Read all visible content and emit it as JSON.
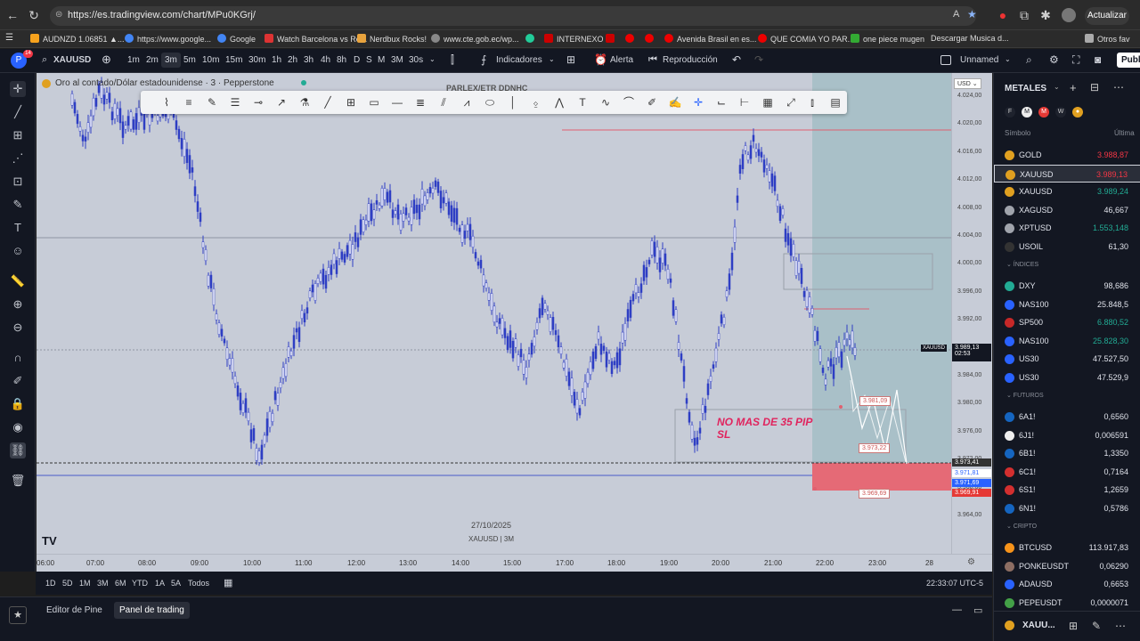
{
  "browser": {
    "url": "https://es.tradingview.com/chart/MPu0KGrj/",
    "update_label": "Actualizar",
    "bookmarks": [
      {
        "label": "AUDNZD 1.06851 ▲...",
        "color": "#f6a21d"
      },
      {
        "label": "https://www.google...",
        "color": "#4285f4"
      },
      {
        "label": "Google",
        "color": "#4285f4"
      },
      {
        "label": "Watch Barcelona vs Re...",
        "color": "#d33"
      },
      {
        "label": "Nerdbux Rocks!",
        "color": "#e8a33d"
      },
      {
        "label": "www.cte.gob.ec/wp...",
        "color": "#888"
      },
      {
        "label": "INTERNEXO",
        "color": "#2c9"
      },
      {
        "label": "",
        "color": "#c00"
      },
      {
        "label": "",
        "color": "#e00"
      },
      {
        "label": "Avenida Brasil en es...",
        "color": "#e00"
      },
      {
        "label": "QUE COMIA YO PAR...",
        "color": "#e00"
      },
      {
        "label": "one piece mugen",
        "color": "#3a3"
      },
      {
        "label": "Descargar Musica d...",
        "color": "#999"
      },
      {
        "label": "Otros fav",
        "color": "#aaa"
      }
    ]
  },
  "header": {
    "avatar_letter": "P",
    "notif_count": "14",
    "symbol": "XAUUSD",
    "timeframes": [
      "1m",
      "2m",
      "3m",
      "5m",
      "10m",
      "15m",
      "30m",
      "1h",
      "2h",
      "3h",
      "4h",
      "8h",
      "D",
      "S",
      "M",
      "3M",
      "30s"
    ],
    "active_timeframe": "3m",
    "indicators_label": "Indicadores",
    "alert_label": "Alerta",
    "replay_label": "Reproducción",
    "layout_name": "Unnamed",
    "publish_label": "Publ"
  },
  "chart": {
    "title": "Oro al contado/Dólar estadounidense · 3 · Pepperstone",
    "overlay_watermark": "PARLEX/ETR DDNHC",
    "annotation_line1": "NO MAS DE 35 PIP",
    "annotation_line2": "SL",
    "label_target": "3.981,09",
    "label_entry": "3.973,22",
    "label_stop": "3.969,69",
    "date_watermark": "27/10/2025",
    "symbol_watermark": "XAUUSD | 3M",
    "currency": "USD",
    "price_ticks": [
      "4.024,00",
      "4.020,00",
      "4.016,00",
      "4.012,00",
      "4.008,00",
      "4.004,00",
      "4.000,00",
      "3.996,00",
      "3.992,00",
      "3.988,00",
      "3.984,00",
      "3.980,00",
      "3.976,00",
      "3.972,00",
      "3.968,00",
      "3.964,00"
    ],
    "current_price_symbol": "XAUUSD",
    "current_price": "3.989,13",
    "countdown": "02:53",
    "axis_label_1": "3.973,41",
    "axis_label_2": "3.971,81",
    "axis_label_3": "3.971,69",
    "axis_label_4": "3.969,91",
    "time_ticks": [
      "06:00",
      "07:00",
      "08:00",
      "09:00",
      "10:00",
      "11:00",
      "12:00",
      "13:00",
      "14:00",
      "15:00",
      "17:00",
      "18:00",
      "19:00",
      "20:00",
      "21:00",
      "22:00",
      "23:00",
      "28"
    ],
    "colors": {
      "bg": "#c7ccd7",
      "candle": "#2f3ec4",
      "target_zone": "#9fbcc3",
      "stop_zone": "#e56a76",
      "annotation": "#e0245e"
    }
  },
  "bottom_bar": {
    "ranges": [
      "1D",
      "5D",
      "1M",
      "3M",
      "6M",
      "YTD",
      "1A",
      "5A",
      "Todos"
    ],
    "clock": "22:33:07 UTC-5"
  },
  "pine_bar": {
    "tab_pine": "Editor de Pine",
    "tab_trading": "Panel de trading"
  },
  "watchlist": {
    "title": "METALES",
    "col_symbol": "Símbolo",
    "col_last": "Última",
    "section_indices": "ÍNDICES",
    "section_futures": "FUTUROS",
    "section_crypto": "CRIPTO",
    "metals": [
      {
        "symbol": "GOLD",
        "value": "3.988,87",
        "color": "#f23645",
        "icon": "#e0a020"
      },
      {
        "symbol": "XAUUSD",
        "value": "3.989,13",
        "color": "#f23645",
        "icon": "#e0a020"
      },
      {
        "symbol": "XAUUSD",
        "value": "3.989,24",
        "color": "#22ab94",
        "icon": "#e0a020"
      },
      {
        "symbol": "XAGUSD",
        "value": "46,667",
        "color": "#e0e3eb",
        "icon": "#a0a4ac"
      },
      {
        "symbol": "XPTUSD",
        "value": "1.553,148",
        "color": "#22ab94",
        "icon": "#a0a4ac"
      },
      {
        "symbol": "USOIL",
        "value": "61,30",
        "color": "#e0e3eb",
        "icon": "#333"
      }
    ],
    "indices": [
      {
        "symbol": "DXY",
        "value": "98,686",
        "color": "#e0e3eb",
        "icon": "#22ab94"
      },
      {
        "symbol": "NAS100",
        "value": "25.848,5",
        "color": "#e0e3eb",
        "icon": "#2962ff"
      },
      {
        "symbol": "SP500",
        "value": "6.880,52",
        "color": "#22ab94",
        "icon": "#c62828"
      },
      {
        "symbol": "NAS100",
        "value": "25.828,30",
        "color": "#22ab94",
        "icon": "#2962ff"
      },
      {
        "symbol": "US30",
        "value": "47.527,50",
        "color": "#e0e3eb",
        "icon": "#2962ff"
      },
      {
        "symbol": "US30",
        "value": "47.529,9",
        "color": "#e0e3eb",
        "icon": "#2962ff"
      }
    ],
    "futures": [
      {
        "symbol": "6A1!",
        "value": "0,6560",
        "color": "#e0e3eb",
        "icon": "#1565c0"
      },
      {
        "symbol": "6J1!",
        "value": "0,006591",
        "color": "#e0e3eb",
        "icon": "#eee"
      },
      {
        "symbol": "6B1!",
        "value": "1,3350",
        "color": "#e0e3eb",
        "icon": "#1565c0"
      },
      {
        "symbol": "6C1!",
        "value": "0,7164",
        "color": "#e0e3eb",
        "icon": "#d32f2f"
      },
      {
        "symbol": "6S1!",
        "value": "1,2659",
        "color": "#e0e3eb",
        "icon": "#d32f2f"
      },
      {
        "symbol": "6N1!",
        "value": "0,5786",
        "color": "#e0e3eb",
        "icon": "#1565c0"
      }
    ],
    "crypto": [
      {
        "symbol": "BTCUSD",
        "value": "113.917,83",
        "color": "#e0e3eb",
        "icon": "#f7931a"
      },
      {
        "symbol": "PONKEUSDT",
        "value": "0,06290",
        "color": "#e0e3eb",
        "icon": "#8d6e63"
      },
      {
        "symbol": "ADAUSD",
        "value": "0,6653",
        "color": "#e0e3eb",
        "icon": "#2962ff"
      },
      {
        "symbol": "PEPEUSDT",
        "value": "0,0000071",
        "color": "#e0e3eb",
        "icon": "#43a047"
      }
    ],
    "footer_symbol": "XAUU..."
  }
}
